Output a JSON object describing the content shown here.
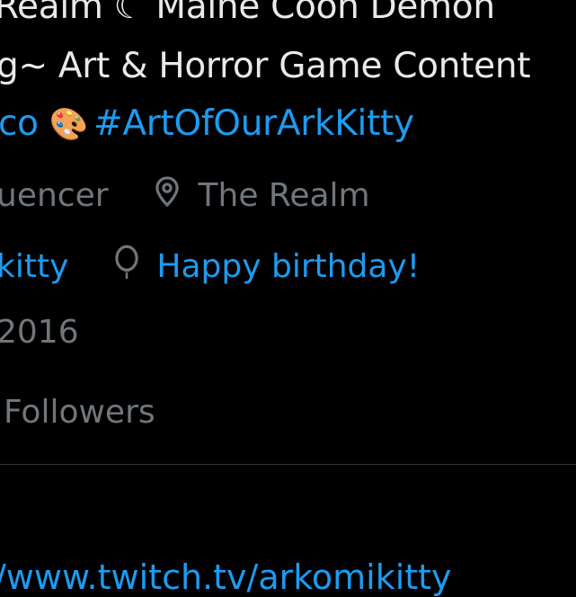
{
  "profile": {
    "bio_line1": "Realm ☾ Maine Coon Demon",
    "bio_line2": "g~ Art & Horror Game Content",
    "bio_line3_prefix": "co",
    "bio_line3_hashtag": "#ArtOfOurArkKitty",
    "category": "uencer",
    "location": "The Realm",
    "website_fragment": "kitty",
    "birthday_text": "Happy birthday!",
    "joined_fragment": "2016",
    "followers_label": "Followers",
    "link_url": "/www.twitch.tv/arkomikitty"
  },
  "icons": {
    "location": "location-pin-icon",
    "birthday": "balloon-icon",
    "palette": "artist-palette-emoji"
  },
  "colors": {
    "background": "#000000",
    "text_primary": "#e7e9ea",
    "text_secondary": "#71767b",
    "link": "#1d9bf0",
    "divider": "#2f3336"
  }
}
